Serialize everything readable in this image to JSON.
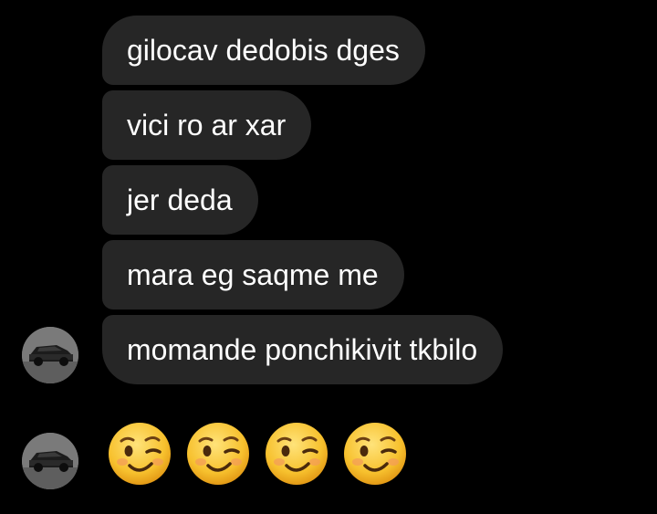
{
  "messages": [
    {
      "text": "gilocav dedobis dges"
    },
    {
      "text": "vici ro ar xar"
    },
    {
      "text": "jer deda"
    },
    {
      "text": "mara eg saqme me"
    },
    {
      "text": "momande ponchikivit tkbilo"
    }
  ],
  "emoji_message": {
    "emojis": [
      "winking-face",
      "winking-face",
      "winking-face",
      "winking-face"
    ]
  },
  "colors": {
    "background": "#000000",
    "bubble": "#262626",
    "text": "#ffffff",
    "emoji_face": "#f7c12e"
  }
}
